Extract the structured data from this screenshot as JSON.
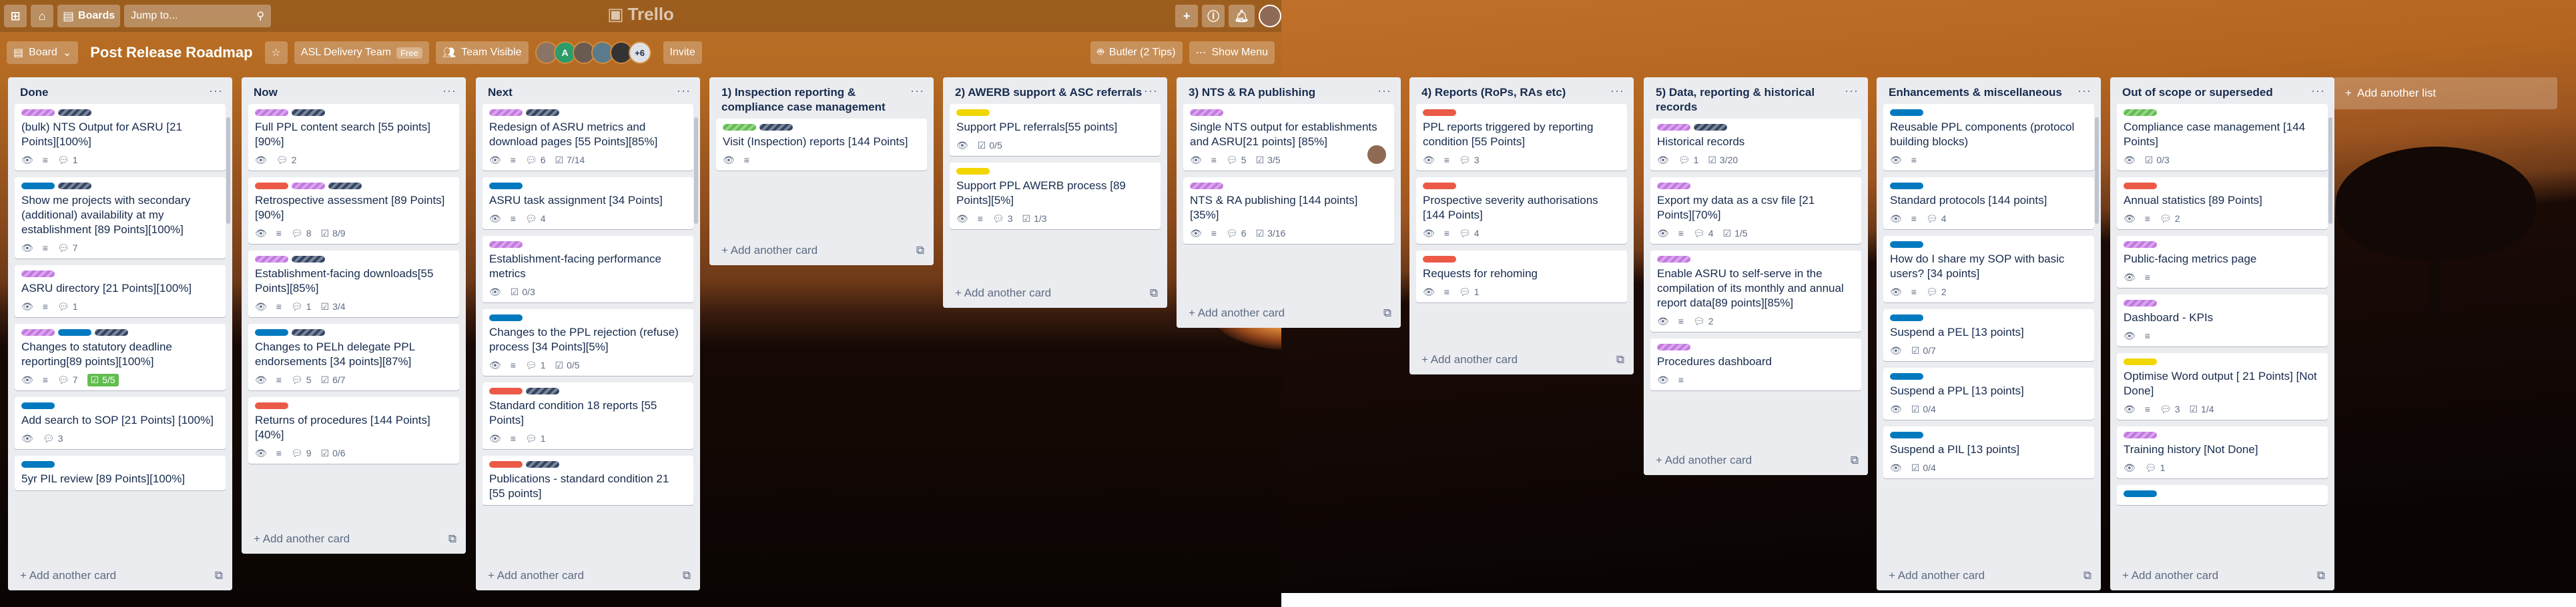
{
  "topbar": {
    "apps_icon": "grid-icon",
    "home_icon": "home-icon",
    "boards_label": "Boards",
    "search_placeholder": "Jump to...",
    "logo": "Trello"
  },
  "boardbar": {
    "board_menu": "Board",
    "title": "Post Release Roadmap",
    "team": "ASL Delivery Team",
    "team_badge": "Free",
    "visibility": "Team Visible",
    "more_members": "+6",
    "invite": "Invite",
    "butler": "Butler (2 Tips)",
    "show_menu": "Show Menu"
  },
  "add_card_label": "Add another card",
  "add_list_label": "Add another list",
  "lists": [
    {
      "title": "Done",
      "cards": [
        {
          "labels": [
            "p",
            "k"
          ],
          "title": "(bulk) NTS Output for ASRU [21 Points][100%]",
          "badges": {
            "desc": true,
            "comments": "1"
          }
        },
        {
          "labels": [
            "b",
            "k"
          ],
          "title": "Show me projects with secondary (additional) availability at my establishment [89 Points][100%]",
          "badges": {
            "desc": true,
            "comments": "7"
          }
        },
        {
          "labels": [
            "p"
          ],
          "title": "ASRU directory [21 Points][100%]",
          "badges": {
            "desc": true,
            "comments": "1"
          }
        },
        {
          "labels": [
            "p",
            "b",
            "k"
          ],
          "title": "Changes to statutory deadline reporting[89 points][100%]",
          "badges": {
            "desc": true,
            "comments": "7",
            "checklist": "5/5",
            "checklist_done": true
          }
        },
        {
          "labels": [
            "b"
          ],
          "title": "Add search to SOP [21 Points] [100%]",
          "badges": {
            "desc": false,
            "comments": "3"
          }
        },
        {
          "labels": [
            "b"
          ],
          "title": "5yr PIL review [89 Points][100%]",
          "badges": {}
        }
      ]
    },
    {
      "title": "Now",
      "cards": [
        {
          "labels": [
            "p",
            "k"
          ],
          "title": "Full PPL content search [55 points] [90%]",
          "badges": {
            "desc": false,
            "comments": "2"
          }
        },
        {
          "labels": [
            "r",
            "p",
            "k"
          ],
          "title": "Retrospective assessment [89 Points][90%]",
          "badges": {
            "desc": true,
            "comments": "8",
            "checklist": "8/9"
          }
        },
        {
          "labels": [
            "p",
            "k"
          ],
          "title": "Establishment-facing downloads[55 Points][85%]",
          "badges": {
            "desc": true,
            "comments": "1",
            "checklist": "3/4"
          }
        },
        {
          "labels": [
            "b",
            "k"
          ],
          "title": "Changes to PELh delegate PPL endorsements [34 points][87%]",
          "badges": {
            "desc": true,
            "comments": "5",
            "checklist": "6/7"
          }
        },
        {
          "labels": [
            "r"
          ],
          "title": "Returns of procedures [144 Points] [40%]",
          "badges": {
            "desc": true,
            "comments": "9",
            "checklist": "0/6"
          }
        }
      ]
    },
    {
      "title": "Next",
      "cards": [
        {
          "labels": [
            "p",
            "k"
          ],
          "title": "Redesign of ASRU metrics and download pages [55 Points][85%]",
          "badges": {
            "desc": true,
            "comments": "6",
            "checklist": "7/14"
          }
        },
        {
          "labels": [
            "b"
          ],
          "title": "ASRU task assignment [34 Points]",
          "badges": {
            "desc": true,
            "comments": "4"
          }
        },
        {
          "labels": [
            "p"
          ],
          "title": "Establishment-facing performance metrics",
          "badges": {
            "checklist": "0/3"
          }
        },
        {
          "labels": [
            "b"
          ],
          "title": "Changes to the PPL rejection (refuse) process [34 Points][5%]",
          "badges": {
            "desc": true,
            "comments": "1",
            "checklist": "0/5"
          }
        },
        {
          "labels": [
            "r",
            "k"
          ],
          "title": "Standard condition 18 reports [55 Points]",
          "badges": {
            "desc": true,
            "comments": "1"
          }
        },
        {
          "labels": [
            "r",
            "k"
          ],
          "title": "Publications - standard condition 21 [55 points]",
          "badges": {}
        }
      ]
    },
    {
      "title": "1) Inspection reporting & compliance case management",
      "cards": [
        {
          "labels": [
            "g",
            "k"
          ],
          "title": "Visit (Inspection) reports [144 Points]",
          "badges": {
            "desc": true
          }
        }
      ]
    },
    {
      "title": "2) AWERB support & ASC referrals",
      "cards": [
        {
          "labels": [
            "y"
          ],
          "title": "Support PPL referrals[55 points]",
          "badges": {
            "checklist": "0/5"
          }
        },
        {
          "labels": [
            "y"
          ],
          "title": "Support PPL AWERB process [89 Points][5%]",
          "badges": {
            "desc": true,
            "comments": "3",
            "checklist": "1/3"
          }
        }
      ]
    },
    {
      "title": "3) NTS & RA publishing",
      "cards": [
        {
          "labels": [
            "p"
          ],
          "title": "Single NTS output for establishments and ASRU[21 points] [85%]",
          "badges": {
            "desc": true,
            "comments": "5",
            "checklist": "3/5"
          },
          "avatar": true
        },
        {
          "labels": [
            "p"
          ],
          "title": "NTS & RA publishing [144 points] [35%]",
          "badges": {
            "desc": true,
            "comments": "6",
            "checklist": "3/16"
          }
        }
      ]
    },
    {
      "title": "4) Reports (RoPs, RAs etc)",
      "cards": [
        {
          "labels": [
            "r"
          ],
          "title": "PPL reports triggered by reporting condition [55 Points]",
          "badges": {
            "desc": true,
            "comments": "3"
          }
        },
        {
          "labels": [
            "r"
          ],
          "title": "Prospective severity authorisations [144 Points]",
          "badges": {
            "desc": true,
            "comments": "4"
          }
        },
        {
          "labels": [
            "r"
          ],
          "title": "Requests for rehoming",
          "badges": {
            "desc": true,
            "comments": "1"
          }
        }
      ]
    },
    {
      "title": "5) Data, reporting & historical records",
      "cards": [
        {
          "labels": [
            "p",
            "k"
          ],
          "title": "Historical records",
          "badges": {
            "desc": false,
            "comments": "1",
            "checklist": "3/20"
          }
        },
        {
          "labels": [
            "p"
          ],
          "title": "Export my data as a csv file [21 Points][70%]",
          "badges": {
            "desc": true,
            "comments": "4",
            "checklist": "1/5"
          }
        },
        {
          "labels": [
            "p"
          ],
          "title": "Enable ASRU to self-serve in the compilation of its monthly and annual report data[89 points][85%]",
          "badges": {
            "desc": true,
            "comments": "2"
          }
        },
        {
          "labels": [
            "p"
          ],
          "title": "Procedures dashboard",
          "badges": {
            "desc": true
          }
        }
      ]
    },
    {
      "title": "Enhancements & miscellaneous",
      "cards": [
        {
          "labels": [
            "b"
          ],
          "title": "Reusable PPL components (protocol building blocks)",
          "badges": {
            "desc": true
          }
        },
        {
          "labels": [
            "b"
          ],
          "title": "Standard protocols [144 points]",
          "badges": {
            "desc": true,
            "comments": "4"
          }
        },
        {
          "labels": [
            "b"
          ],
          "title": "How do I share my SOP with basic users? [34 points]",
          "badges": {
            "desc": true,
            "comments": "2"
          }
        },
        {
          "labels": [
            "b"
          ],
          "title": "Suspend a PEL [13 points]",
          "badges": {
            "checklist": "0/7"
          }
        },
        {
          "labels": [
            "b"
          ],
          "title": "Suspend a PPL [13 points]",
          "badges": {
            "checklist": "0/4"
          }
        },
        {
          "labels": [
            "b"
          ],
          "title": "Suspend a PIL [13 points]",
          "badges": {
            "checklist": "0/4"
          }
        }
      ]
    },
    {
      "title": "Out of scope or superseded",
      "cards": [
        {
          "labels": [
            "g"
          ],
          "title": "Compliance case management [144 Points]",
          "badges": {
            "checklist": "0/3"
          }
        },
        {
          "labels": [
            "r"
          ],
          "title": "Annual statistics [89 Points]",
          "badges": {
            "desc": true,
            "comments": "2"
          }
        },
        {
          "labels": [
            "p"
          ],
          "title": "Public-facing metrics page",
          "badges": {
            "desc": true
          }
        },
        {
          "labels": [
            "p"
          ],
          "title": "Dashboard - KPIs",
          "badges": {
            "desc": true
          }
        },
        {
          "labels": [
            "y"
          ],
          "title": "Optimise Word output [ 21 Points] [Not Done]",
          "badges": {
            "desc": true,
            "comments": "3",
            "checklist": "1/4"
          }
        },
        {
          "labels": [
            "p"
          ],
          "title": "Training history [Not Done]",
          "badges": {
            "comments": "1"
          }
        },
        {
          "labels": [
            "b"
          ],
          "title": "",
          "badges": {}
        }
      ]
    }
  ]
}
